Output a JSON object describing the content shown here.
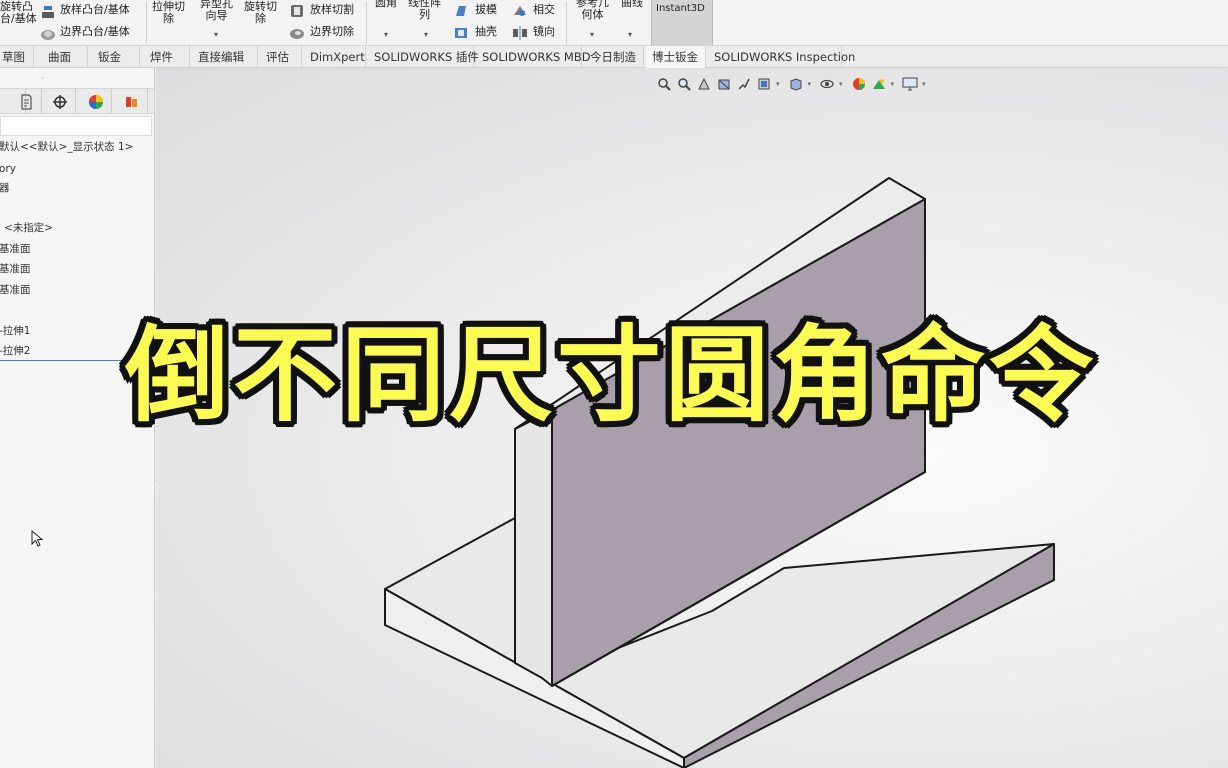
{
  "ribbon": {
    "revolve_boss_label": "旋转凸\n台/基体",
    "loft_boss_label": "放样凸台/基体",
    "boundary_boss_label": "边界凸台/基体",
    "extruded_cut_label": "拉伸切\n除",
    "hole_wizard_label": "异型孔\n向导",
    "revolved_cut_label": "旋转切\n除",
    "lofted_cut_label": "放样切割",
    "boundary_cut_label": "边界切除",
    "fillet_label": "圆角",
    "linear_pattern_label": "线性阵\n列",
    "draft_label": "拔模",
    "shell_label": "抽壳",
    "intersect_label": "相交",
    "mirror_label": "镜向",
    "reference_geometry_label": "参考几\n何体",
    "curves_label": "曲线",
    "instant3d_label": "Instant3D",
    "dropdown_glyph": "▾"
  },
  "tabs": [
    {
      "label": "草图"
    },
    {
      "label": "曲面"
    },
    {
      "label": "钣金"
    },
    {
      "label": "焊件"
    },
    {
      "label": "直接编辑"
    },
    {
      "label": "评估"
    },
    {
      "label": "DimXpert"
    },
    {
      "label": "SOLIDWORKS 插件"
    },
    {
      "label": "SOLIDWORKS MBD"
    },
    {
      "label": "今日制造"
    },
    {
      "label": "博士钣金"
    },
    {
      "label": "SOLIDWORKS Inspection"
    }
  ],
  "feature_tree": {
    "items": [
      {
        "label": "默认<<默认>_显示状态 1>"
      },
      {
        "label": "ory"
      },
      {
        "label": "器"
      },
      {
        "label": "<未指定>"
      },
      {
        "label": "基准面"
      },
      {
        "label": "基准面"
      },
      {
        "label": "基准面"
      },
      {
        "label": "-拉伸1"
      },
      {
        "label": "-拉伸2"
      }
    ]
  },
  "overlay": {
    "title": "倒不同尺寸圆角命令"
  },
  "colors": {
    "overlay_fill": "#fbfb54",
    "overlay_outline": "#111111",
    "model_face_light": "#e9e9e9",
    "model_face_purple": "#a99fab",
    "model_edge": "#1a1a1a"
  }
}
